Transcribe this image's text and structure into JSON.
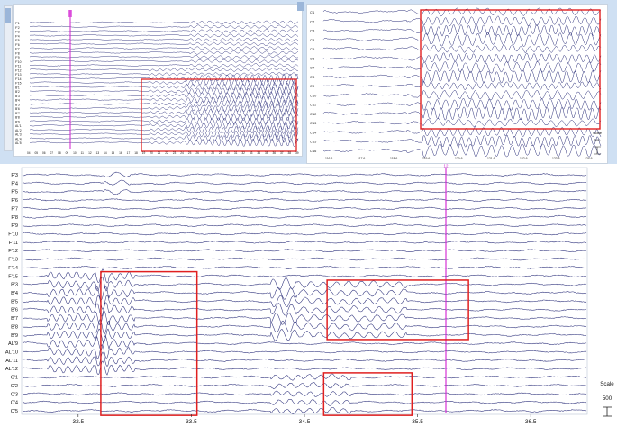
{
  "panel_top_left": {
    "channel_labels": [
      "F'1",
      "F'2",
      "F'3",
      "F'4",
      "F'5",
      "F'6",
      "F'7",
      "F'8",
      "F'9",
      "F'10",
      "F'11",
      "F'12",
      "F'13",
      "F'14",
      "F'15",
      "B'1",
      "B'2",
      "B'3",
      "B'4",
      "B'5",
      "B'6",
      "B'7",
      "B'8",
      "B'9",
      "AL'1",
      "AL'2",
      "AL'3",
      "AL'4",
      "AL'5"
    ],
    "x_ticks": [
      "04",
      "05",
      "06",
      "07",
      "08",
      "09",
      "10",
      "11",
      "12",
      "13",
      "14",
      "15",
      "16",
      "17",
      "18",
      "19",
      "20",
      "21",
      "22",
      "23",
      "24",
      "25",
      "26",
      "27",
      "28",
      "29",
      "30",
      "31",
      "32",
      "33",
      "34",
      "35",
      "36",
      "37",
      "38",
      "39"
    ]
  },
  "panel_top_right": {
    "channel_labels": [
      "C'1",
      "C'2",
      "C'3",
      "C'4",
      "C'5",
      "C'6",
      "C'7",
      "C'8",
      "C'9",
      "C'10",
      "C'11",
      "C'12",
      "C'13",
      "C'14",
      "C'15",
      "C'16"
    ],
    "x_ticks": [
      "116.6",
      "117.6",
      "118.6",
      "119.6",
      "120.6",
      "121.6",
      "122.6",
      "123.6",
      "124.6"
    ],
    "scale_label": "Scale",
    "scale_value": "500"
  },
  "panel_bottom": {
    "channel_labels": [
      "F'3",
      "F'4",
      "F'5",
      "F'6",
      "F'7",
      "F'8",
      "F'9",
      "F'10",
      "F'11",
      "F'12",
      "F'13",
      "F'14",
      "F'15",
      "B'3",
      "B'4",
      "B'5",
      "B'6",
      "B'7",
      "B'8",
      "B'9",
      "AL'9",
      "AL'10",
      "AL'11",
      "AL'12",
      "C'1",
      "C'2",
      "C'3",
      "C'4",
      "C'5"
    ],
    "x_ticks": [
      "32.5",
      "33.5",
      "34.5",
      "35.5",
      "36.5"
    ],
    "marker_label": "12",
    "scale_label": "Scale",
    "scale_value": "500"
  },
  "colors": {
    "trace": "#2b2f7a",
    "highlight_box": "#e02020",
    "cursor": "#d21fd2",
    "background": "#cfe0f3"
  },
  "chart_data": {
    "type": "line",
    "title": "",
    "xlabel": "",
    "ylabel": "",
    "xlim": [
      32.0,
      37.0
    ],
    "cursor_x": 35.75,
    "highlight_regions": [
      {
        "x": [
          32.7,
          33.55
        ],
        "channels": [
          "F'15",
          "C'5"
        ]
      },
      {
        "x": [
          34.7,
          35.95
        ],
        "channels": [
          "B'3",
          "B'9"
        ]
      },
      {
        "x": [
          34.67,
          35.45
        ],
        "channels": [
          "C'1",
          "C'5"
        ]
      }
    ],
    "grid": false
  }
}
